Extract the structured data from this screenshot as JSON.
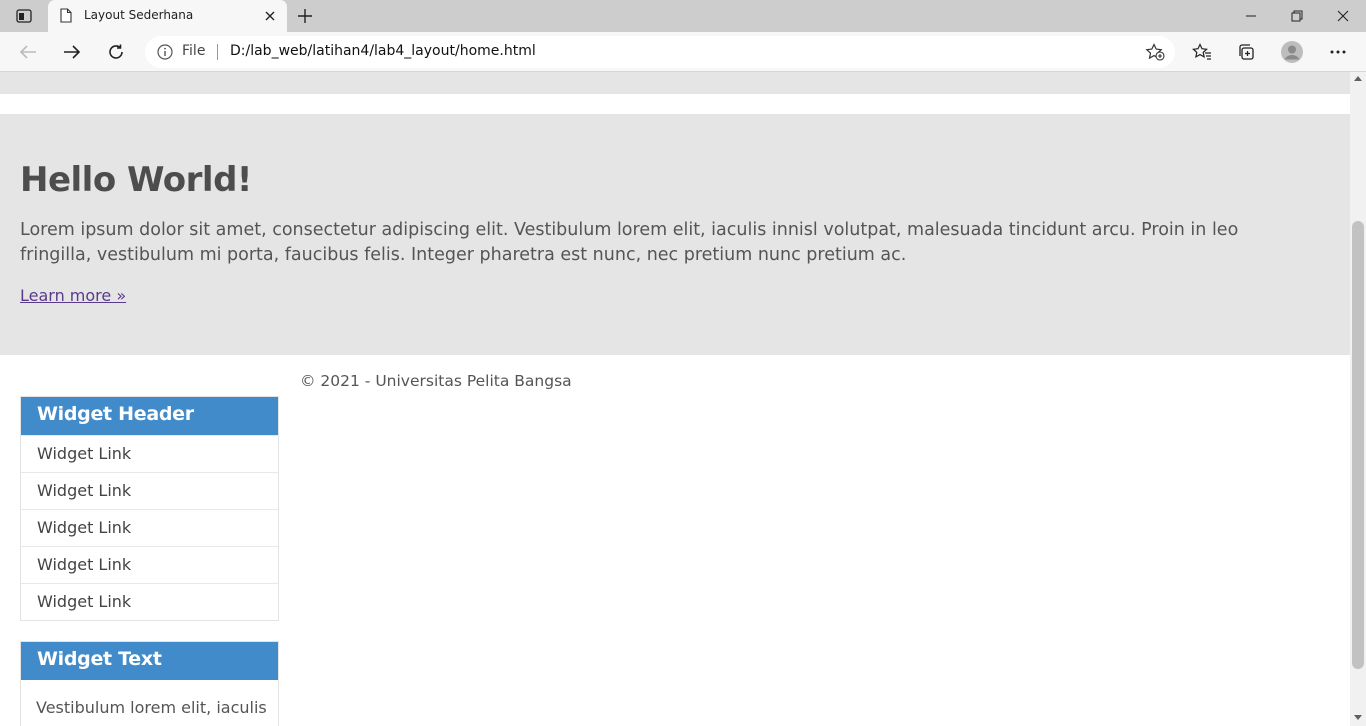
{
  "browser": {
    "tab_title": "Layout Sederhana",
    "address_scheme": "File",
    "address_url": "D:/lab_web/latihan4/lab4_layout/home.html"
  },
  "hero": {
    "heading": "Hello World!",
    "paragraph": "Lorem ipsum dolor sit amet, consectetur adipiscing elit. Vestibulum lorem elit, iaculis innisl volutpat, malesuada tincidunt arcu. Proin in leo fringilla, vestibulum mi porta, faucibus felis. Integer pharetra est nunc, nec pretium nunc pretium ac.",
    "link": "Learn more »"
  },
  "widgets": {
    "links_header": "Widget Header",
    "links": [
      "Widget Link",
      "Widget Link",
      "Widget Link",
      "Widget Link",
      "Widget Link"
    ],
    "text_header": "Widget Text",
    "text_body": "Vestibulum lorem elit, iaculis"
  },
  "footer": {
    "text": "© 2021 - Universitas Pelita Bangsa"
  },
  "colors": {
    "widget_header_bg": "#428bca",
    "hero_bg": "#e5e5e5",
    "link": "#5a3a8a"
  },
  "icons": {
    "tab_actions": "tab-actions-icon",
    "page": "page-icon",
    "close": "close-icon",
    "new_tab": "plus-icon",
    "minimize": "minimize-icon",
    "restore": "restore-icon",
    "window_close": "close-icon",
    "back": "back-arrow-icon",
    "forward": "forward-arrow-icon",
    "refresh": "refresh-icon",
    "info": "info-icon",
    "add_favorite": "star-plus-icon",
    "favorites": "favorites-icon",
    "collections": "collections-icon",
    "profile": "profile-icon",
    "more": "more-icon"
  }
}
